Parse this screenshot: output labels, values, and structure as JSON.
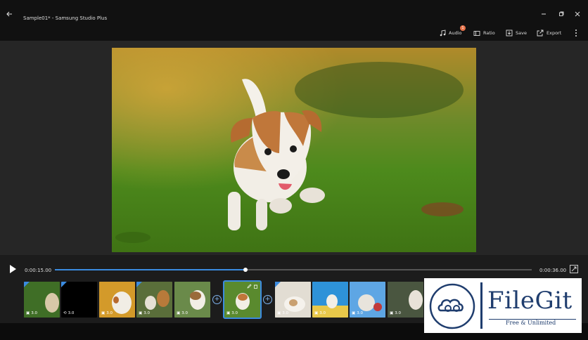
{
  "window": {
    "title": "Sample01* - Samsung Studio Plus"
  },
  "toolbar": {
    "audio_label": "Audio",
    "audio_badge": "1",
    "ratio_label": "Ratio",
    "save_label": "Save",
    "export_label": "Export"
  },
  "player": {
    "current_time": "0:00:15.00",
    "total_time": "0:00:36.00",
    "progress": 0.4
  },
  "timeline": {
    "clips": [
      {
        "duration": "3.0",
        "type": "image"
      },
      {
        "duration": "3.0",
        "type": "video"
      },
      {
        "duration": "3.0",
        "type": "image"
      },
      {
        "duration": "3.0",
        "type": "image"
      },
      {
        "duration": "3.0",
        "type": "image"
      },
      {
        "duration": "3.0",
        "type": "image"
      },
      {
        "duration": "3.0",
        "type": "image"
      },
      {
        "duration": "3.0",
        "type": "image"
      },
      {
        "duration": "3.0",
        "type": "image"
      },
      {
        "duration": "3.0",
        "type": "image"
      },
      {
        "duration": "3.0",
        "type": "image"
      }
    ]
  },
  "watermark": {
    "brand": "FileGit",
    "tagline": "Free & Unlimited"
  },
  "colors": {
    "accent": "#3b8be0",
    "badge": "#e8734a"
  }
}
